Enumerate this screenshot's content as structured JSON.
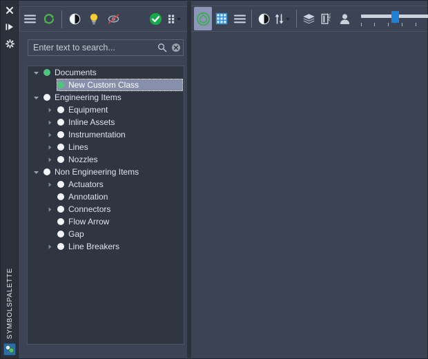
{
  "window": {
    "background_color": "#3b4354",
    "panel_background_color": "#2f3541",
    "accent_green": "#4fc47a",
    "accent_blue": "#1e7fd4",
    "selection_color": "#868fac"
  },
  "rail": {
    "title": "SYMBOLSPALETTE",
    "icons": [
      {
        "name": "close-icon",
        "glyph": "✕"
      },
      {
        "name": "auto-hide-icon",
        "glyph": "▶|"
      },
      {
        "name": "settings-icon",
        "glyph": "✸"
      }
    ],
    "bottom_tab": {
      "name": "symbol-palette-tab",
      "label": ""
    }
  },
  "left_toolbar": {
    "buttons": [
      {
        "name": "menu-button",
        "icon": "hamburger-menu-icon",
        "label": "Menu",
        "active": false
      },
      {
        "name": "refresh-button",
        "icon": "refresh-icon",
        "label": "Refresh",
        "active": false
      },
      {
        "name": "contrast-button",
        "icon": "half-circle-icon",
        "label": "Contrast",
        "active": false
      },
      {
        "name": "highlight-button",
        "icon": "lightbulb-icon",
        "label": "Highlight",
        "active": false
      },
      {
        "name": "disable-preview-button",
        "icon": "no-preview-icon",
        "label": "Disable Preview",
        "active": false
      },
      {
        "name": "validate-button",
        "icon": "green-check-icon",
        "label": "Validate",
        "active": false
      },
      {
        "name": "grid-options-button",
        "icon": "dot-grid-icon",
        "label": "Options",
        "active": false
      }
    ]
  },
  "search": {
    "value": "",
    "placeholder": "Enter text to search...",
    "search_icon": "search-icon",
    "clear_icon": "clear-icon"
  },
  "tree": {
    "nodes": [
      {
        "label": "Documents",
        "depth": 0,
        "expanded": true,
        "has_arrow": true,
        "dot": "green",
        "selected": false
      },
      {
        "label": "New Custom Class",
        "depth": 1,
        "expanded": false,
        "has_arrow": false,
        "dot": "green",
        "selected": true
      },
      {
        "label": "Engineering Items",
        "depth": 0,
        "expanded": true,
        "has_arrow": true,
        "dot": "white",
        "selected": false
      },
      {
        "label": "Equipment",
        "depth": 1,
        "expanded": false,
        "has_arrow": true,
        "dot": "white",
        "selected": false
      },
      {
        "label": "Inline Assets",
        "depth": 1,
        "expanded": false,
        "has_arrow": true,
        "dot": "white",
        "selected": false
      },
      {
        "label": "Instrumentation",
        "depth": 1,
        "expanded": false,
        "has_arrow": true,
        "dot": "white",
        "selected": false
      },
      {
        "label": "Lines",
        "depth": 1,
        "expanded": false,
        "has_arrow": true,
        "dot": "white",
        "selected": false
      },
      {
        "label": "Nozzles",
        "depth": 1,
        "expanded": false,
        "has_arrow": true,
        "dot": "white",
        "selected": false
      },
      {
        "label": "Non Engineering Items",
        "depth": 0,
        "expanded": true,
        "has_arrow": true,
        "dot": "white",
        "selected": false
      },
      {
        "label": "Actuators",
        "depth": 1,
        "expanded": false,
        "has_arrow": true,
        "dot": "white",
        "selected": false
      },
      {
        "label": "Annotation",
        "depth": 1,
        "expanded": false,
        "has_arrow": false,
        "dot": "white",
        "selected": false
      },
      {
        "label": "Connectors",
        "depth": 1,
        "expanded": false,
        "has_arrow": true,
        "dot": "white",
        "selected": false
      },
      {
        "label": "Flow Arrow",
        "depth": 1,
        "expanded": false,
        "has_arrow": false,
        "dot": "white",
        "selected": false
      },
      {
        "label": "Gap",
        "depth": 1,
        "expanded": false,
        "has_arrow": false,
        "dot": "white",
        "selected": false
      },
      {
        "label": "Line Breakers",
        "depth": 1,
        "expanded": false,
        "has_arrow": true,
        "dot": "white",
        "selected": false
      }
    ]
  },
  "right_toolbar": {
    "buttons": [
      {
        "name": "symbol-view-button",
        "icon": "green-circle-icon",
        "label": "Symbols",
        "active": true
      },
      {
        "name": "grid-view-button",
        "icon": "blue-grid-icon",
        "label": "Grid View",
        "active": false
      },
      {
        "name": "list-view-button",
        "icon": "list-view-icon",
        "label": "List View",
        "active": false
      },
      {
        "name": "contrast-button",
        "icon": "half-circle-icon",
        "label": "Contrast",
        "active": false
      },
      {
        "name": "sort-button",
        "icon": "sort-arrows-icon",
        "label": "Sort",
        "active": false
      },
      {
        "name": "layers-button",
        "icon": "layers-icon",
        "label": "Layers",
        "active": false
      },
      {
        "name": "label-button",
        "icon": "abc-label-icon",
        "label": "Labels",
        "active": false
      },
      {
        "name": "user-button",
        "icon": "person-icon",
        "label": "User",
        "active": false
      }
    ],
    "slider": {
      "name": "zoom-slider",
      "value": 50,
      "min": 0,
      "max": 100,
      "tick_count": 6
    }
  }
}
